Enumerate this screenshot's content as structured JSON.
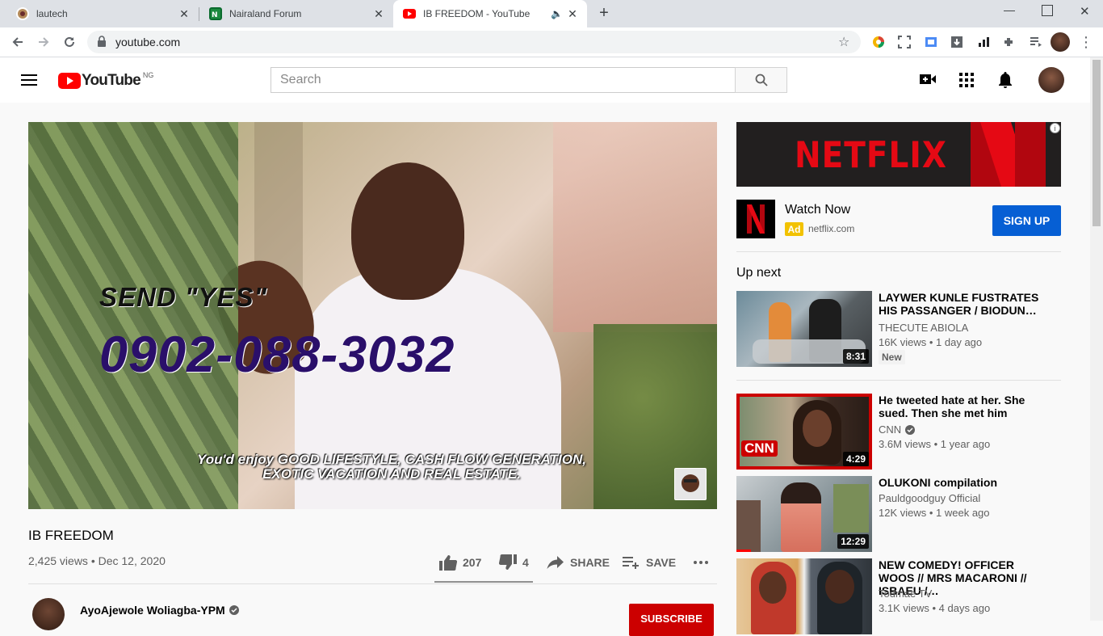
{
  "browser": {
    "tabs": [
      {
        "title": "lautech",
        "active": false
      },
      {
        "title": "Nairaland Forum",
        "active": false
      },
      {
        "title": "IB FREEDOM - YouTube",
        "active": true
      }
    ],
    "url": "youtube.com"
  },
  "youtube": {
    "logo_text": "YouTube",
    "region": "NG",
    "search_placeholder": "Search"
  },
  "video": {
    "overlay_send": "SEND \"YES\"",
    "overlay_phone": "0902-088-3032",
    "overlay_caption_line1": "You'd enjoy GOOD LIFESTYLE, CASH FLOW GENERATION,",
    "overlay_caption_line2": "EXOTIC VACATION AND REAL ESTATE.",
    "title": "IB FREEDOM",
    "meta": "2,425 views • Dec 12, 2020",
    "likes": "207",
    "dislikes": "4",
    "share_label": "SHARE",
    "save_label": "SAVE",
    "channel": "AyoAjewole Woliagba-YPM",
    "subscribe_label": "SUBSCRIBE"
  },
  "ad": {
    "banner_text": "NETFLIX",
    "info": "i",
    "title": "Watch Now",
    "badge": "Ad",
    "domain": "netflix.com",
    "cta": "SIGN UP"
  },
  "upnext_label": "Up next",
  "recommendations": [
    {
      "title": "LAYWER KUNLE FUSTRATES HIS PASSANGER / BIODUN…",
      "channel": "THECUTE ABIOLA",
      "views": "16K views • 1 day ago",
      "duration": "8:31",
      "badge": "New"
    },
    {
      "title": "He tweeted hate at her. She sued. Then she met him",
      "channel": "CNN",
      "views": "3.6M views • 1 year ago",
      "duration": "4:29"
    },
    {
      "title": "OLUKONI compilation",
      "channel": "Pauldgoodguy Official",
      "views": "12K views • 1 week ago",
      "duration": "12:29"
    },
    {
      "title": "NEW COMEDY! OFFICER WOOS // MRS MACARONI // ISBAEU /…",
      "channel": "Todmae TV",
      "views": "3.1K views • 4 days ago"
    }
  ],
  "colors": {
    "brand_red": "#ff0000",
    "link_blue": "#065fd4",
    "netflix_red": "#e50914"
  }
}
